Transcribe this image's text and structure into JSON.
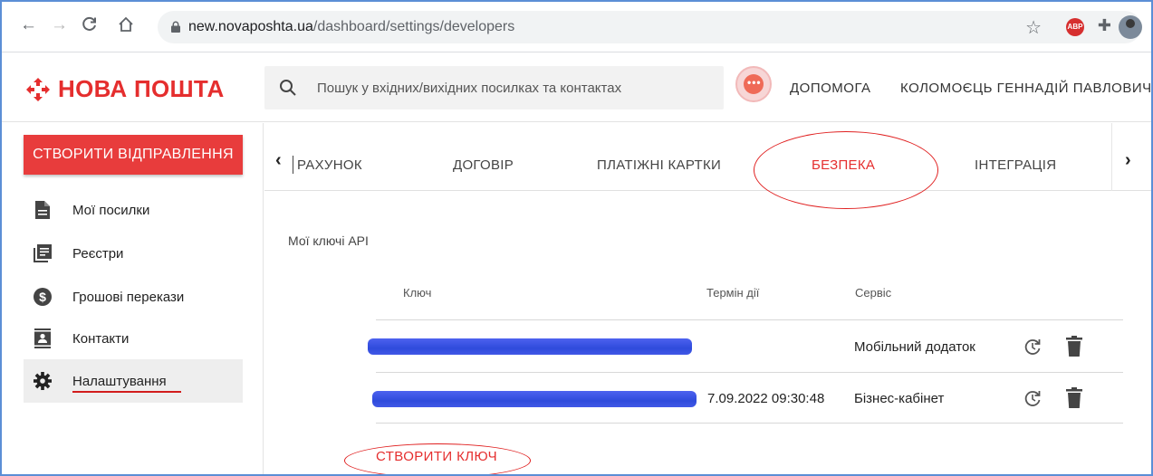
{
  "browser": {
    "url_host": "new.novaposhta.ua",
    "url_path": "/dashboard/settings/developers",
    "extension_badge": "ABP"
  },
  "header": {
    "logo_text": "НОВА ПОШТА",
    "search_placeholder": "Пошук у вхідних/вихідних посилках та контактах",
    "help_label": "ДОПОМОГА",
    "user_name": "КОЛОМОЄЦЬ ГЕННАДІЙ ПАВЛОВИЧ"
  },
  "sidebar": {
    "create_button": "СТВОРИТИ ВІДПРАВЛЕННЯ",
    "items": [
      {
        "label": "Мої посилки",
        "icon": "document-icon"
      },
      {
        "label": "Реєстри",
        "icon": "registry-icon"
      },
      {
        "label": "Грошові перекази",
        "icon": "dollar-icon"
      },
      {
        "label": "Контакти",
        "icon": "contact-icon"
      },
      {
        "label": "Налаштування",
        "icon": "gear-icon",
        "active": true
      }
    ]
  },
  "tabs": {
    "items": [
      "РАХУНОК",
      "ДОГОВІР",
      "ПЛАТІЖНІ КАРТКИ",
      "БЕЗПЕКА",
      "ІНТЕГРАЦІЯ"
    ],
    "active": "БЕЗПЕКА",
    "prev_arrow": "‹",
    "next_arrow": "›"
  },
  "content": {
    "section_title": "Мої ключі API",
    "columns": [
      "Ключ",
      "Термін дії",
      "Сервіс"
    ],
    "rows": [
      {
        "key": "",
        "expiry": "",
        "service": "Мобільний додаток"
      },
      {
        "key": "",
        "expiry": "7.09.2022 09:30:48",
        "service": "Бізнес-кабінет"
      }
    ],
    "create_key": "СТВОРИТИ КЛЮЧ"
  },
  "colors": {
    "brand_red": "#e52e2e",
    "button_red": "#e83c3c",
    "redaction_blue": "#2f4bdc"
  }
}
